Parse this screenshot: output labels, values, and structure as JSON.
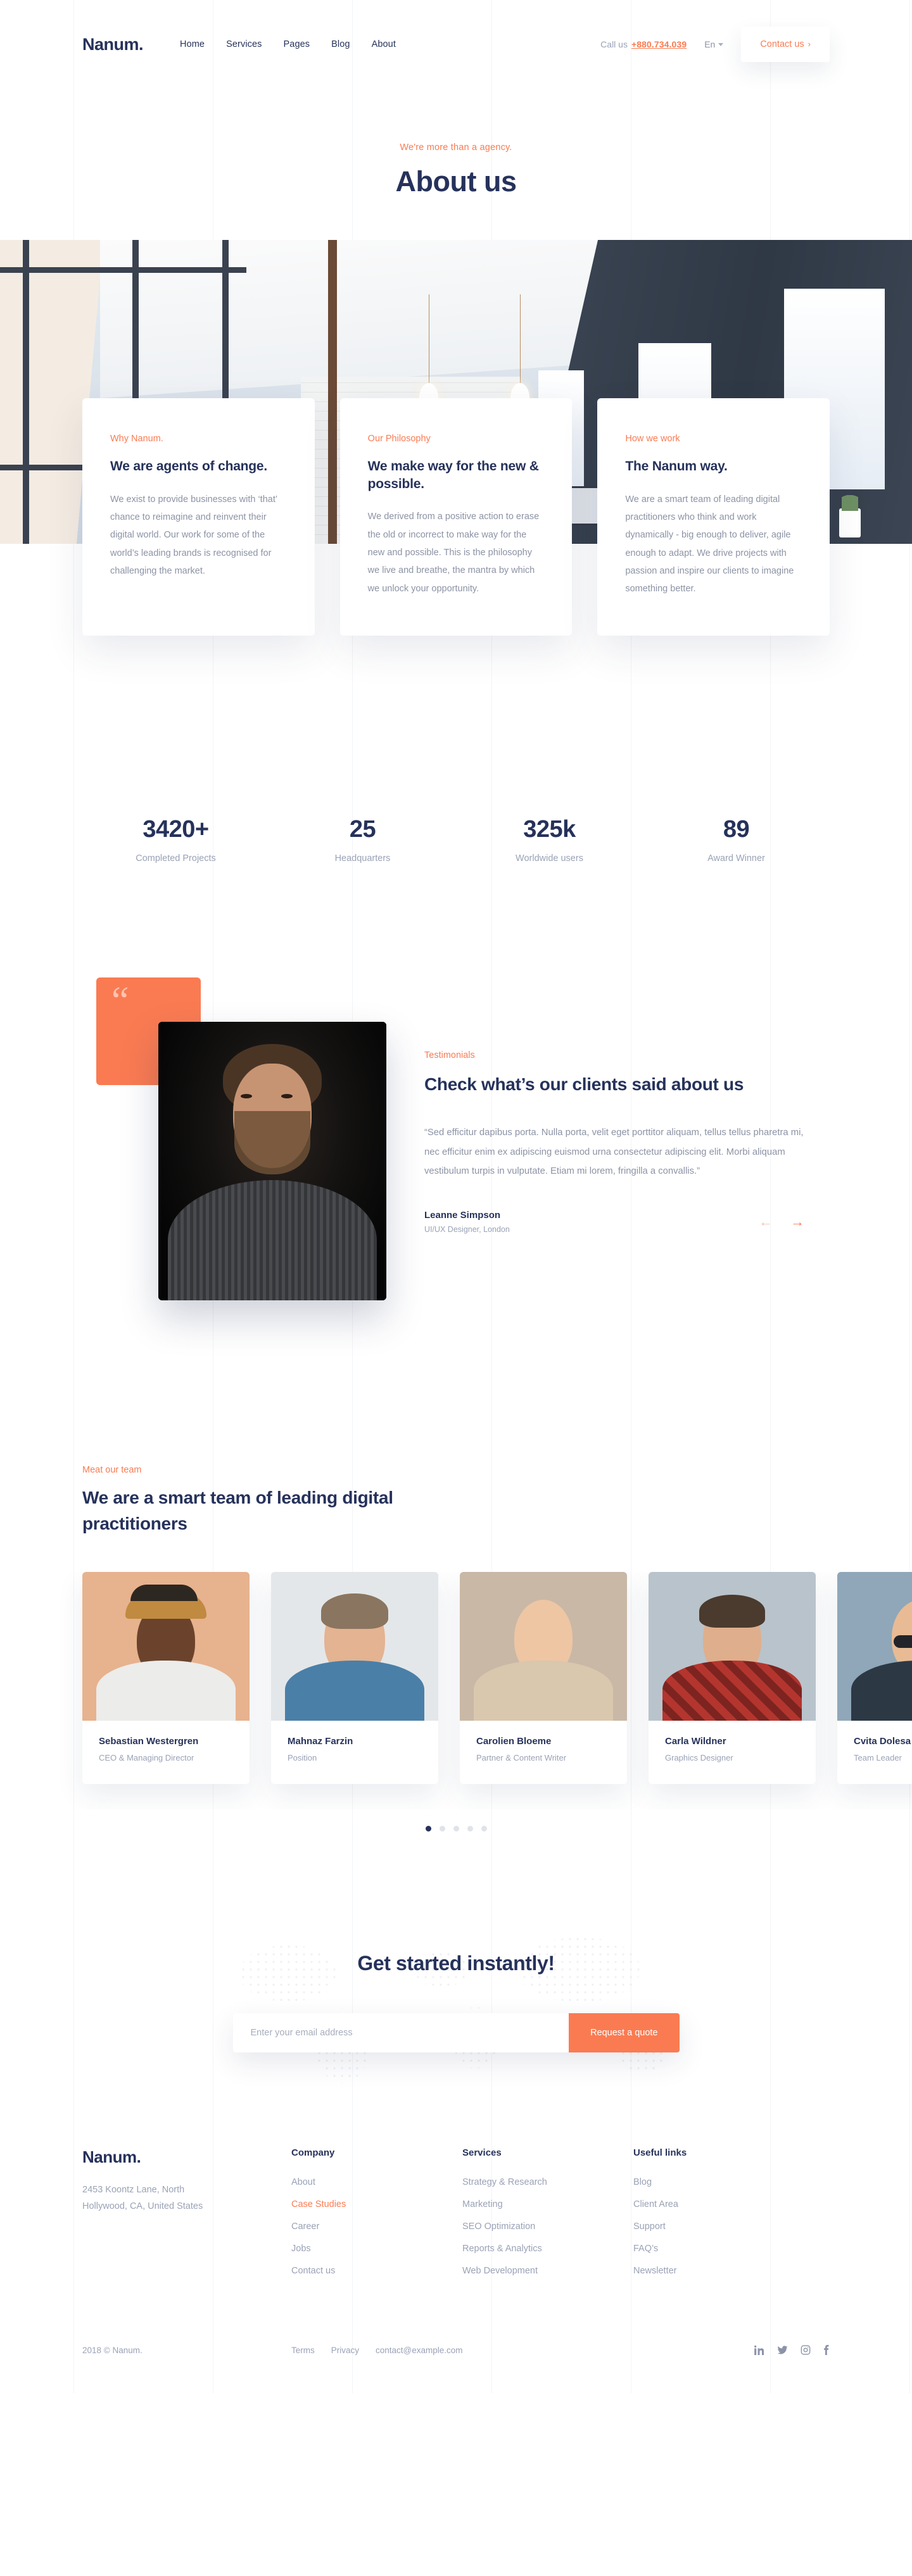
{
  "brand": {
    "name": "Nanum."
  },
  "header": {
    "nav": [
      {
        "label": "Home"
      },
      {
        "label": "Services"
      },
      {
        "label": "Pages"
      },
      {
        "label": "Blog"
      },
      {
        "label": "About"
      }
    ],
    "call_us_label": "Call us",
    "phone": "+880.734.039",
    "language": "En",
    "contact_button": "Contact us",
    "contact_button_chevron": "›"
  },
  "hero": {
    "eyebrow": "We're more than a agency.",
    "title": "About us"
  },
  "cards": [
    {
      "tag": "Why Nanum.",
      "title": "We are agents of change.",
      "body": "We exist to provide businesses with ‘that’ chance to reimagine and reinvent their digital world. Our work for some of the world’s leading brands is recognised for challenging the market."
    },
    {
      "tag": "Our Philosophy",
      "title": "We make way for the new & possible.",
      "body": "We derived from a positive action to erase the old or incorrect to make way for the new and possible. This is the philosophy we live and breathe, the mantra by which we unlock your opportunity."
    },
    {
      "tag": "How we work",
      "title": "The Nanum way.",
      "body": "We are a smart team of leading digital practitioners who think and work dynamically - big enough to deliver, agile enough to adapt. We drive projects with passion and inspire our clients to imagine something better."
    }
  ],
  "stats": [
    {
      "num": "3420+",
      "label": "Completed Projects"
    },
    {
      "num": "25",
      "label": "Headquarters"
    },
    {
      "num": "325k",
      "label": "Worldwide users"
    },
    {
      "num": "89",
      "label": "Award Winner"
    }
  ],
  "testimonials": {
    "quote_mark": "“",
    "tag": "Testimonials",
    "title": "Check what’s our clients said about us",
    "quote": "“Sed efficitur dapibus porta. Nulla porta, velit eget porttitor aliquam, tellus tellus pharetra mi, nec efficitur enim ex adipiscing euismod urna consectetur adipiscing elit. Morbi aliquam vestibulum turpis in vulputate. Etiam mi lorem, fringilla a convallis.”",
    "author": "Leanne Simpson",
    "author_role": "UI/UX Designer, London",
    "prev_arrow": "←",
    "next_arrow": "→"
  },
  "team": {
    "tag": "Meat our team",
    "title": "We are a smart team of leading digital practitioners",
    "members": [
      {
        "name": "Sebastian Westergren",
        "position": "CEO & Managing Director"
      },
      {
        "name": "Mahnaz Farzin",
        "position": "Position"
      },
      {
        "name": "Carolien Bloeme",
        "position": "Partner & Content Writer"
      },
      {
        "name": "Carla Wildner",
        "position": "Graphics Designer"
      },
      {
        "name": "Cvita Dolesa",
        "position": "Team Leader"
      }
    ],
    "dots": [
      {
        "active": true
      },
      {
        "active": false
      },
      {
        "active": false
      },
      {
        "active": false
      },
      {
        "active": false
      }
    ]
  },
  "cta": {
    "title": "Get started instantly!",
    "email_placeholder": "Enter your email address",
    "email_value": "",
    "button": "Request a quote"
  },
  "footer": {
    "address": "2453  Koontz Lane, North Hollywood, CA, United States",
    "columns": [
      {
        "heading": "Company",
        "links": [
          {
            "label": "About",
            "active": false
          },
          {
            "label": "Case Studies",
            "active": true
          },
          {
            "label": "Career",
            "active": false
          },
          {
            "label": "Jobs",
            "active": false
          },
          {
            "label": "Contact us",
            "active": false
          }
        ]
      },
      {
        "heading": "Services",
        "links": [
          {
            "label": "Strategy & Research",
            "active": false
          },
          {
            "label": "Marketing",
            "active": false
          },
          {
            "label": "SEO Optimization",
            "active": false
          },
          {
            "label": "Reports & Analytics",
            "active": false
          },
          {
            "label": "Web Development",
            "active": false
          }
        ]
      },
      {
        "heading": "Useful links",
        "links": [
          {
            "label": "Blog",
            "active": false
          },
          {
            "label": "Client Area",
            "active": false
          },
          {
            "label": "Support",
            "active": false
          },
          {
            "label": "FAQ’s",
            "active": false
          },
          {
            "label": "Newsletter",
            "active": false
          }
        ]
      }
    ],
    "copyright": "2018 © Nanum.",
    "bottom_links": [
      {
        "label": "Terms"
      },
      {
        "label": "Privacy"
      },
      {
        "label": "contact@example.com"
      }
    ],
    "social": [
      {
        "icon": "linkedin-icon"
      },
      {
        "icon": "twitter-icon"
      },
      {
        "icon": "instagram-icon"
      },
      {
        "icon": "facebook-icon"
      }
    ]
  },
  "colors": {
    "accent": "#fa7b52",
    "navy": "#26325b",
    "muted": "#9aa2b6"
  }
}
